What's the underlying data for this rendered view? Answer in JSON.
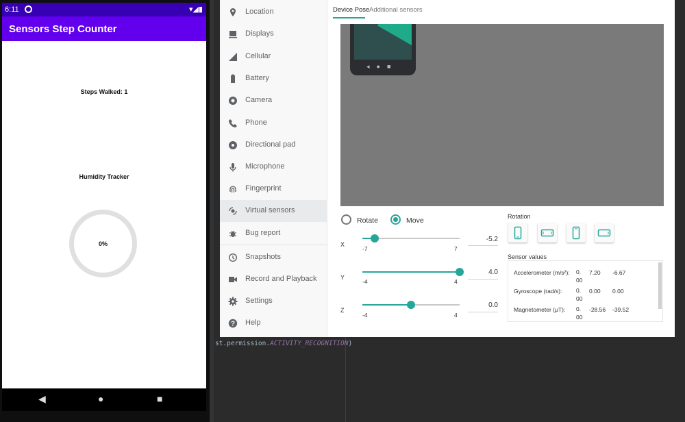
{
  "phone": {
    "status_time": "6:11",
    "app_title": "Sensors Step Counter",
    "steps_text": "Steps Walked: 1",
    "humidity_title": "Humidity Tracker",
    "humidity_progress_text": "0%",
    "humidity_progress_fraction": 0.0
  },
  "sidebar": {
    "items": [
      {
        "label": "Location",
        "icon": "location-pin-icon"
      },
      {
        "label": "Displays",
        "icon": "display-icon"
      },
      {
        "label": "Cellular",
        "icon": "cellular-signal-icon"
      },
      {
        "label": "Battery",
        "icon": "battery-icon"
      },
      {
        "label": "Camera",
        "icon": "camera-icon"
      },
      {
        "label": "Phone",
        "icon": "phone-icon"
      },
      {
        "label": "Directional pad",
        "icon": "dpad-icon"
      },
      {
        "label": "Microphone",
        "icon": "microphone-icon"
      },
      {
        "label": "Fingerprint",
        "icon": "fingerprint-icon"
      },
      {
        "label": "Virtual sensors",
        "icon": "virtual-sensors-icon"
      },
      {
        "label": "Bug report",
        "icon": "bug-icon"
      },
      {
        "label": "Snapshots",
        "icon": "snapshot-history-icon"
      },
      {
        "label": "Record and Playback",
        "icon": "video-camera-icon"
      },
      {
        "label": "Settings",
        "icon": "gear-icon"
      },
      {
        "label": "Help",
        "icon": "help-icon"
      }
    ],
    "active_item": "Virtual sensors"
  },
  "tabs": {
    "device_pose": "Device Pose",
    "additional_sensors": "Additional sensors"
  },
  "pose": {
    "rotate_label": "Rotate",
    "move_label": "Move",
    "selected_mode": "Move",
    "sliders": [
      {
        "axis": "X",
        "min": "-7",
        "max": "7",
        "value_text": "-5.2",
        "value": -5.2,
        "range": [
          -7,
          7
        ]
      },
      {
        "axis": "Y",
        "min": "-4",
        "max": "4",
        "value_text": "4.0",
        "value": 4.0,
        "range": [
          -4,
          4
        ]
      },
      {
        "axis": "Z",
        "min": "-4",
        "max": "4",
        "value_text": "0.0",
        "value": 0.0,
        "range": [
          -4,
          4
        ]
      }
    ]
  },
  "rotation": {
    "title": "Rotation"
  },
  "sensor_values": {
    "title": "Sensor values",
    "rows": [
      {
        "name": "Accelerometer (m/s²):",
        "v1": "0.\n00",
        "v2": "7.20",
        "v3": "-6.67"
      },
      {
        "name": "Gyroscope (rad/s):",
        "v1": "0.\n00",
        "v2": "0.00",
        "v3": "0.00"
      },
      {
        "name": "Magnetometer (μT):",
        "v1": "0.\n00",
        "v2": "-28.56",
        "v3": "-39.52"
      }
    ]
  },
  "ide": {
    "code_prefix": "st.permission.",
    "code_keyword": "ACTIVITY_RECOGNITION",
    "code_suffix": ")"
  },
  "colors": {
    "accent": "#26a69a",
    "app_bar": "#6200ee",
    "status_bar": "#3700b3"
  }
}
